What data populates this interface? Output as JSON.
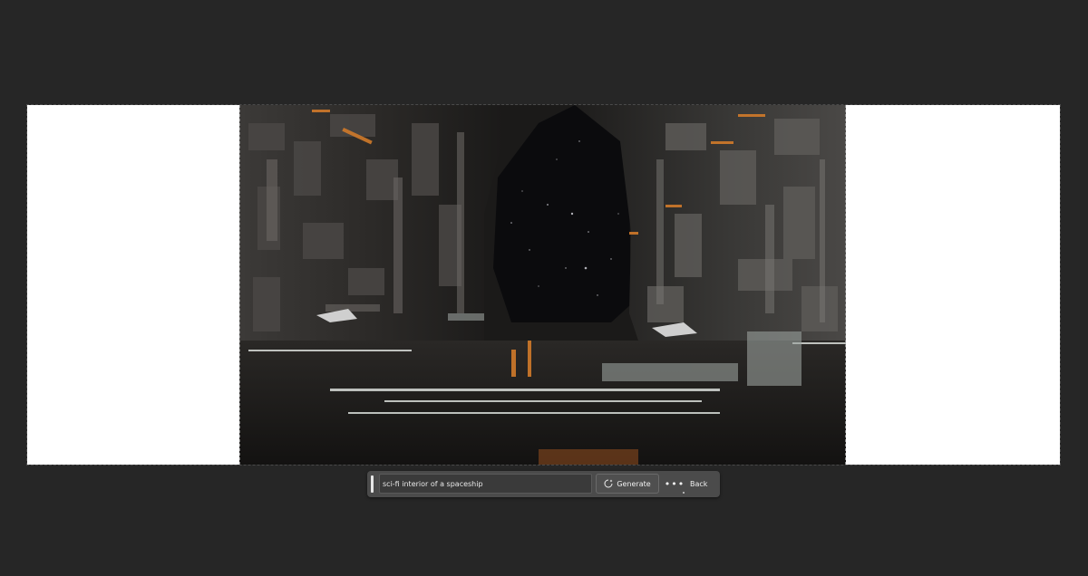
{
  "app": {
    "background_color": "#262626",
    "canvas_color": "#ffffff"
  },
  "canvas": {
    "image_subject": "sci-fi spaceship interior artwork"
  },
  "contextual_taskbar": {
    "prompt_value": "sci-fi interior of a spaceship",
    "generate_label": "Generate",
    "generate_icon": "generative-fill-icon",
    "more_label": "•••",
    "more_icon": "more-options-icon",
    "back_label": "Back"
  }
}
